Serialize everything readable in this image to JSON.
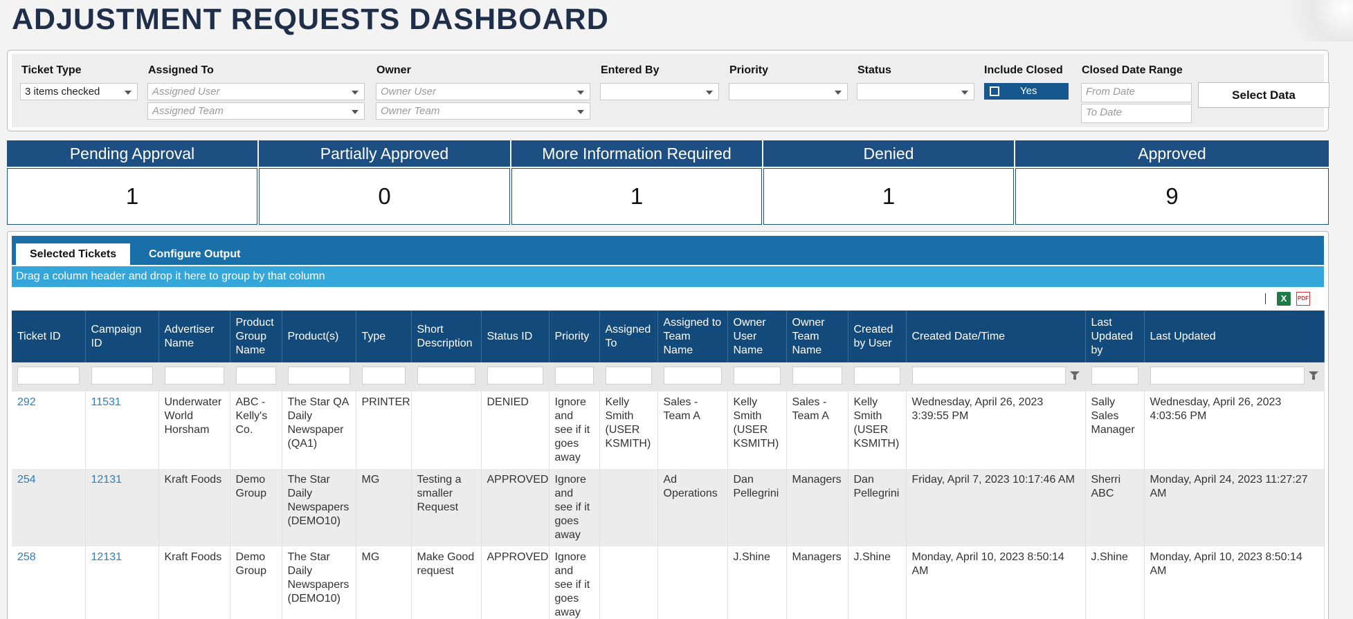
{
  "title": "ADJUSTMENT REQUESTS DASHBOARD",
  "filters": {
    "ticket_type": {
      "label": "Ticket Type",
      "value": "3 items checked"
    },
    "assigned_to": {
      "label": "Assigned To",
      "user_placeholder": "Assigned User",
      "team_placeholder": "Assigned Team"
    },
    "owner": {
      "label": "Owner",
      "user_placeholder": "Owner User",
      "team_placeholder": "Owner Team"
    },
    "entered_by": {
      "label": "Entered By",
      "value": ""
    },
    "priority": {
      "label": "Priority",
      "value": ""
    },
    "status": {
      "label": "Status",
      "value": ""
    },
    "include_closed": {
      "label": "Include Closed",
      "value": "Yes"
    },
    "closed_date_range": {
      "label": "Closed Date Range",
      "from_placeholder": "From Date",
      "to_placeholder": "To Date"
    },
    "select_button": "Select Data"
  },
  "kpis": [
    {
      "label": "Pending Approval",
      "value": "1"
    },
    {
      "label": "Partially Approved",
      "value": "0"
    },
    {
      "label": "More Information Required",
      "value": "1"
    },
    {
      "label": "Denied",
      "value": "1"
    },
    {
      "label": "Approved",
      "value": "9"
    }
  ],
  "tabs": [
    {
      "label": "Selected Tickets",
      "active": true
    },
    {
      "label": "Configure Output",
      "active": false
    }
  ],
  "group_hint": "Drag a column header and drop it here to group by that column",
  "toolbar": {
    "excel_icon": "excel-export-icon",
    "pdf_icon": "pdf-export-icon"
  },
  "columns": [
    "Ticket ID",
    "Campaign ID",
    "Advertiser Name",
    "Product Group Name",
    "Product(s)",
    "Type",
    "Short Description",
    "Status ID",
    "Priority",
    "Assigned To",
    "Assigned to Team Name",
    "Owner User Name",
    "Owner Team Name",
    "Created by User",
    "Created Date/Time",
    "Last Updated by",
    "Last Updated"
  ],
  "rows": [
    [
      "292",
      "11531",
      "Underwater World Horsham",
      "ABC - Kelly's Co.",
      "The Star QA Daily Newspaper (QA1)",
      "PRINTER",
      "",
      "DENIED",
      "Ignore and see if it goes away",
      "Kelly Smith (USER KSMITH)",
      "Sales - Team A",
      "Kelly Smith (USER KSMITH)",
      "Sales - Team A",
      "Kelly Smith (USER KSMITH)",
      "Wednesday, April 26, 2023 3:39:55 PM",
      "Sally Sales Manager",
      "Wednesday, April 26, 2023 4:03:56 PM"
    ],
    [
      "254",
      "12131",
      "Kraft Foods",
      "Demo Group",
      "The Star Daily Newspapers (DEMO10)",
      "MG",
      "Testing a smaller Request",
      "APPROVED",
      "Ignore and see if it goes away",
      "",
      "Ad Operations",
      "Dan Pellegrini",
      "Managers",
      "Dan Pellegrini",
      "Friday, April 7, 2023 10:17:46 AM",
      "Sherri ABC",
      "Monday, April 24, 2023 11:27:27 AM"
    ],
    [
      "258",
      "12131",
      "Kraft Foods",
      "Demo Group",
      "The Star Daily Newspapers (DEMO10)",
      "MG",
      "Make Good request",
      "APPROVED",
      "Ignore and see if it goes away",
      "",
      "",
      "J.Shine",
      "Managers",
      "J.Shine",
      "Monday, April 10, 2023 8:50:14 AM",
      "J.Shine",
      "Monday, April 10, 2023 8:50:14 AM"
    ]
  ]
}
